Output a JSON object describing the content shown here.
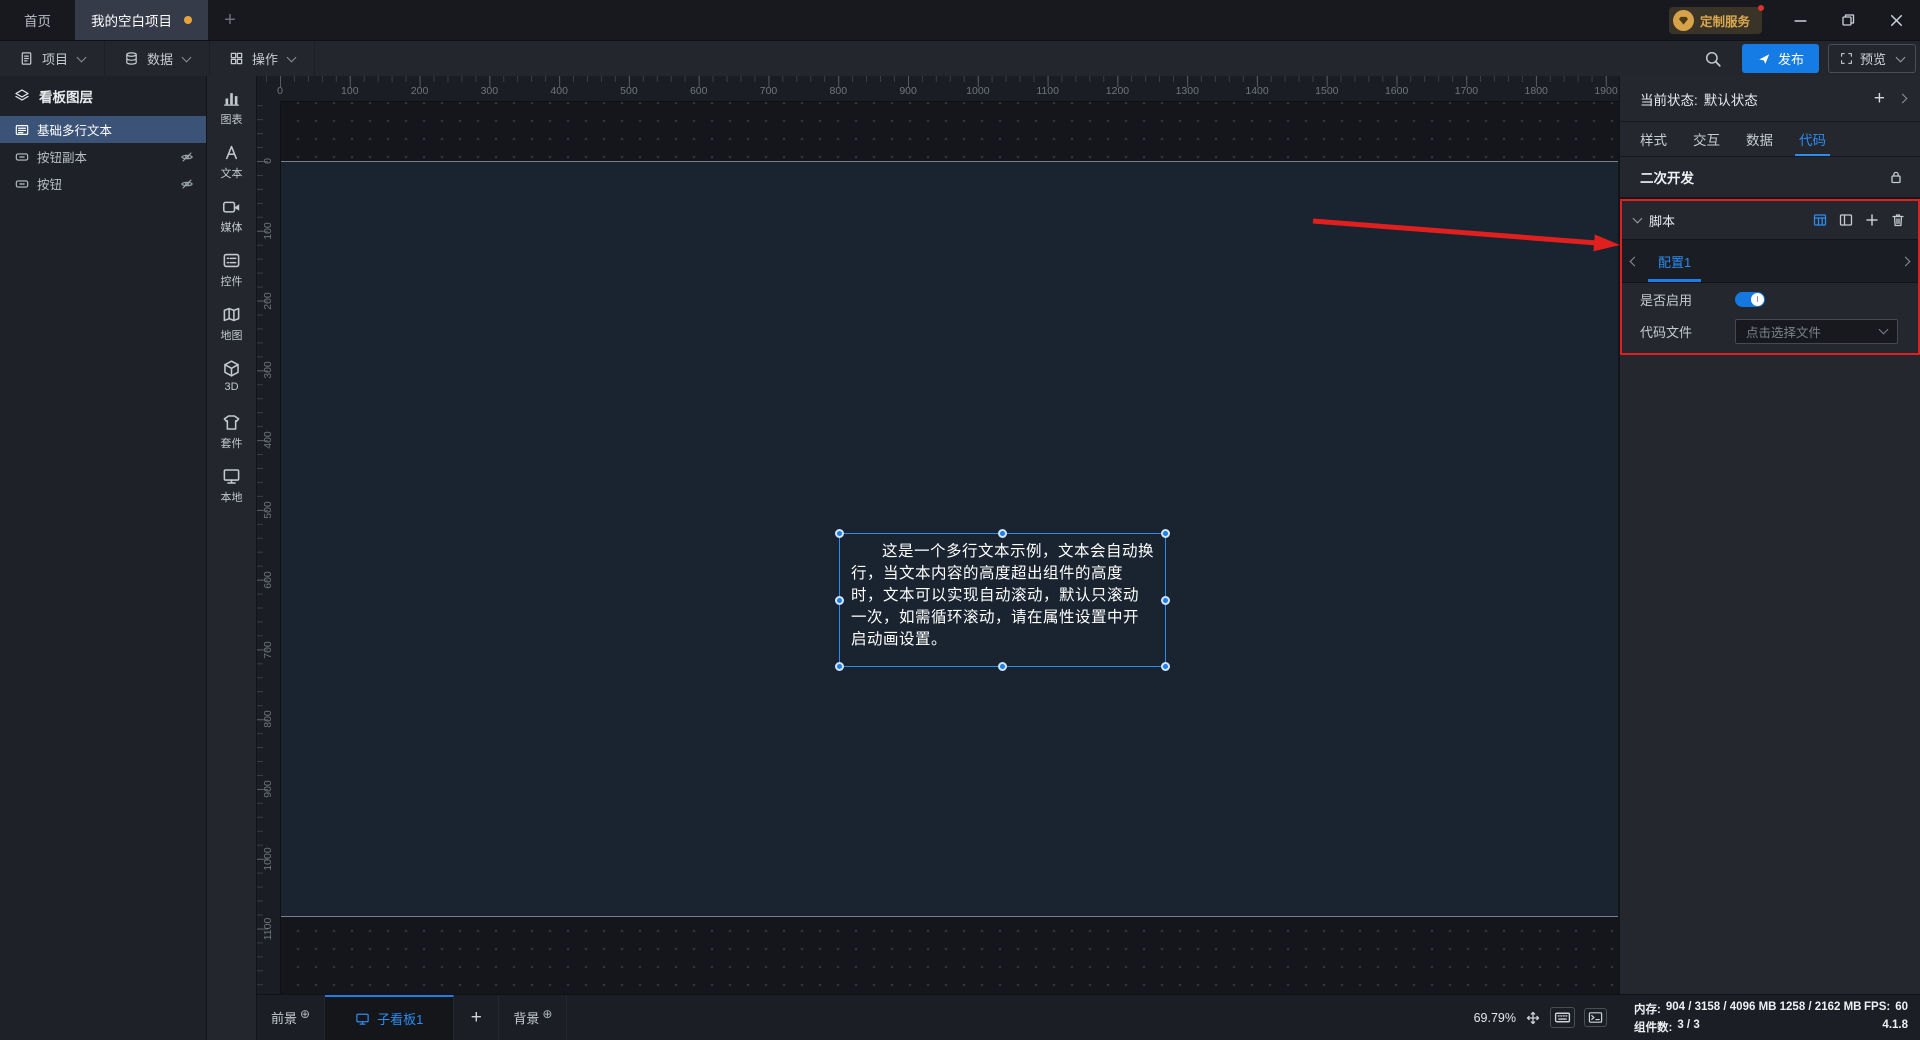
{
  "titlebar": {
    "doc_tabs": [
      {
        "label": "首页",
        "active": false,
        "modified": false
      },
      {
        "label": "我的空白项目",
        "active": true,
        "modified": true
      }
    ],
    "new_tab_label": "+",
    "service_badge_label": "定制服务"
  },
  "menubar": {
    "items": [
      {
        "icon": "document-icon",
        "label": "项目"
      },
      {
        "icon": "database-icon",
        "label": "数据"
      },
      {
        "icon": "grid-icon",
        "label": "操作"
      }
    ],
    "publish_label": "发布",
    "preview_label": "预览"
  },
  "layers_panel": {
    "title": "看板图层",
    "items": [
      {
        "label": "基础多行文本",
        "icon": "multiline-text-icon",
        "selected": true,
        "hidden": false
      },
      {
        "label": "按钮副本",
        "icon": "button-icon",
        "selected": false,
        "hidden": true
      },
      {
        "label": "按钮",
        "icon": "button-icon",
        "selected": false,
        "hidden": true
      }
    ]
  },
  "component_toolbar": {
    "items": [
      {
        "icon": "chart-icon",
        "label": "图表"
      },
      {
        "icon": "text-tool-icon",
        "label": "文本"
      },
      {
        "icon": "media-icon",
        "label": "媒体"
      },
      {
        "icon": "widget-icon",
        "label": "控件"
      },
      {
        "icon": "map-icon",
        "label": "地图"
      },
      {
        "icon": "cube-3d-icon",
        "label": "3D"
      },
      {
        "icon": "kit-icon",
        "label": "套件"
      },
      {
        "icon": "local-icon",
        "label": "本地"
      }
    ]
  },
  "canvas": {
    "h_ruler_labels": [
      0,
      100,
      200,
      300,
      400,
      500,
      600,
      700,
      800,
      900,
      1000,
      1100,
      1200,
      1300,
      1400,
      1500,
      1600,
      1700,
      1800,
      1900
    ],
    "v_ruler_labels": [
      0,
      100,
      200,
      300,
      400,
      500,
      600,
      700,
      800,
      900,
      1000,
      1100
    ],
    "text_element": {
      "content": "这是一个多行文本示例，文本会自动换行，当文本内容的高度超出组件的高度时，文本可以实现自动滚动，默认只滚动一次，如需循环滚动，请在属性设置中开启动画设置。"
    }
  },
  "inspector": {
    "state_label": "当前状态:",
    "state_value": "默认状态",
    "tabs": [
      {
        "label": "样式",
        "active": false
      },
      {
        "label": "交互",
        "active": false
      },
      {
        "label": "数据",
        "active": false
      },
      {
        "label": "代码",
        "active": true
      }
    ],
    "secondary_dev_label": "二次开发",
    "script": {
      "title": "脚本",
      "config_tab": "配置1",
      "enable_label": "是否启用",
      "enabled": true,
      "code_file_label": "代码文件",
      "code_file_placeholder": "点击选择文件"
    }
  },
  "bottom_bar": {
    "foreground_label": "前景",
    "board_tab_label": "子看板1",
    "add_label": "+",
    "background_label": "背景",
    "zoom_level": "69.79%",
    "memory_label": "内存:",
    "memory_value": "904 / 3158 / 4096 MB  1258 / 2162 MB",
    "fps_label": "FPS:",
    "fps_value": "60",
    "components_label": "组件数:",
    "components_value": "3 / 3",
    "version": "4.1.8"
  },
  "colors": {
    "accent_blue": "#2d8cf0",
    "publish_blue": "#157be5",
    "selection_blue": "#2d8cf0",
    "active_tab_dot": "#e8a33d",
    "annotation_red": "#e01f1f",
    "board_bg": "#1a2330",
    "badge_gold": "#d9a850"
  }
}
